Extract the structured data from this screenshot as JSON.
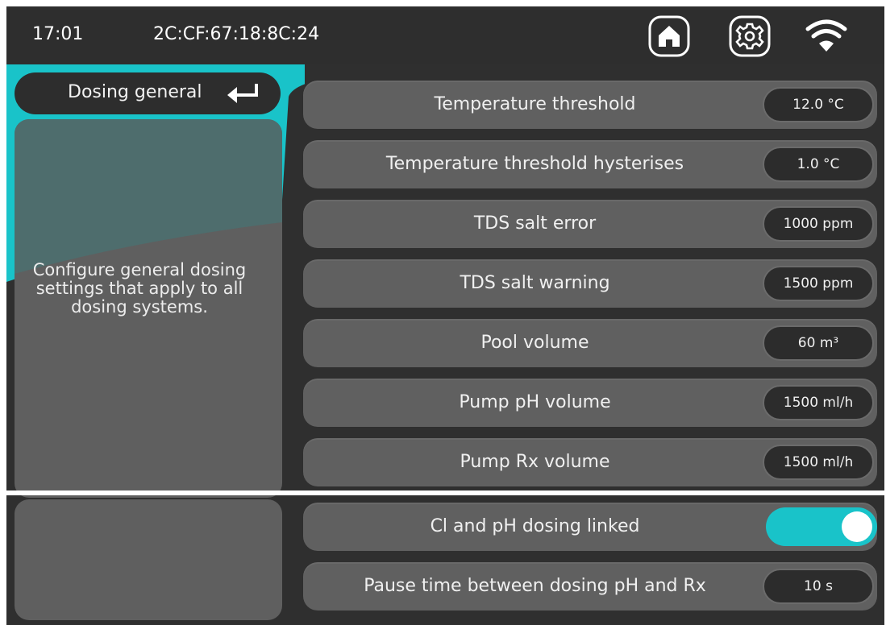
{
  "status_bar": {
    "time": "17:01",
    "mac_address": "2C:CF:67:18:8C:24",
    "icons": [
      "home-icon",
      "gear-icon",
      "wifi-icon"
    ]
  },
  "section": {
    "title": "Dosing general",
    "back_icon": "return-arrow-icon",
    "description": "Configure general dosing settings that apply to all dosing systems."
  },
  "settings": [
    {
      "label": "Temperature threshold",
      "value": "12.0 °C"
    },
    {
      "label": "Temperature threshold hysterises",
      "value": "1.0 °C"
    },
    {
      "label": "TDS salt error",
      "value": "1000 ppm"
    },
    {
      "label": "TDS salt warning",
      "value": "1500 ppm"
    },
    {
      "label": "Pool volume",
      "value": "60 m³"
    },
    {
      "label": "Pump pH volume",
      "value": "1500 ml/h"
    },
    {
      "label": "Pump Rx volume",
      "value": "1500 ml/h"
    },
    {
      "label": "Cl and pH dosing linked",
      "toggle_on": true
    },
    {
      "label": "Pause time between dosing pH and Rx",
      "value": "10 s"
    }
  ],
  "colors": {
    "accent": "#19c3c9",
    "background": "#2f2f2f",
    "row": "#606060",
    "pill": "#2c2c2c"
  }
}
